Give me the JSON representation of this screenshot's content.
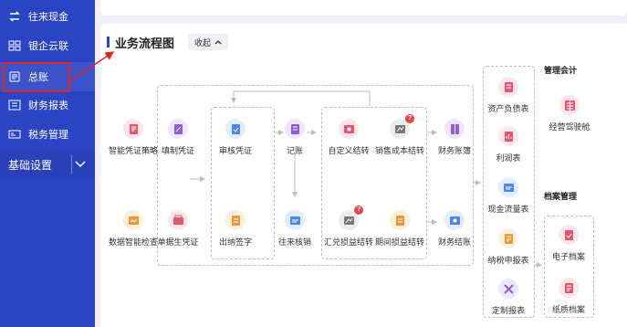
{
  "colors": {
    "sidebar": "#2b44c4",
    "highlight": "#e02525",
    "accent_pink": "#e2566e",
    "accent_orange": "#e9973a",
    "accent_purple": "#8b5cd6",
    "accent_blue": "#4a86e8",
    "badge": "#e84545"
  },
  "sidebar": {
    "items": [
      {
        "label": "往来现金",
        "icon": "exchange-icon"
      },
      {
        "label": "银企云联",
        "icon": "grid-icon"
      },
      {
        "label": "总账",
        "icon": "ledger-icon"
      },
      {
        "label": "财务报表",
        "icon": "report-icon"
      },
      {
        "label": "税务管理",
        "icon": "tax-icon"
      }
    ],
    "section": "基础设置"
  },
  "header": {
    "title": "业务流程图",
    "collapse_label": "收起"
  },
  "flow": {
    "col1": [
      "智能凭证策略",
      "数据智能检查"
    ],
    "col2": [
      "填制凭证",
      "单据生凭证"
    ],
    "col3": [
      "审核凭证",
      "出纳签字"
    ],
    "col4": [
      "记账",
      "往来核销"
    ],
    "col5": [
      "自定义结转",
      "汇兑损益结转"
    ],
    "col6": [
      "销售成本结转",
      "期间损益结转"
    ],
    "col7": [
      "财务账簿",
      "财务结账"
    ],
    "reports": [
      "资产负债表",
      "利润表",
      "现金流量表",
      "纳税申报表",
      "定制报表"
    ],
    "management_title": "管理会计",
    "management": [
      "经营驾驶舱"
    ],
    "archive_title": "档案管理",
    "archive": [
      "电子档案",
      "纸质档案"
    ],
    "badge": "?"
  }
}
